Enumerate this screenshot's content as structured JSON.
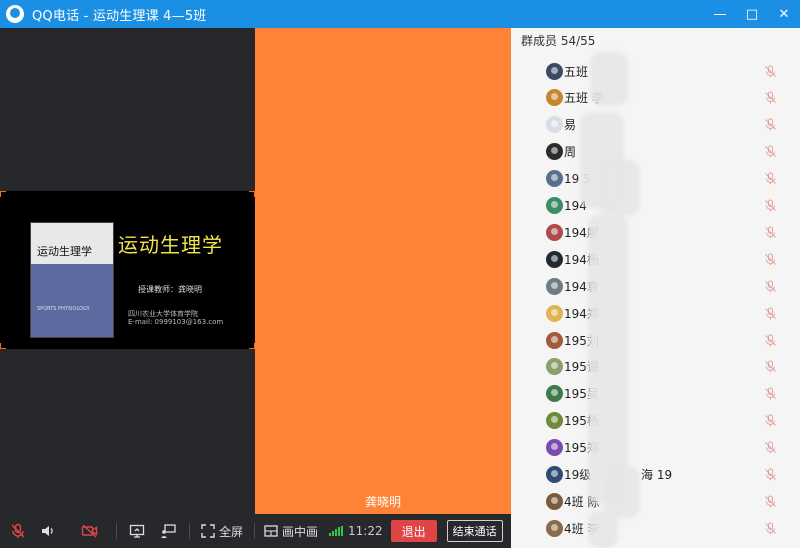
{
  "window": {
    "title": "QQ电话 - 运动生理课  4—5班",
    "controls": [
      "—",
      "□",
      "✕"
    ]
  },
  "slide": {
    "book_title": "运动生理学",
    "book_sub": "SPORTS PHYSIOLOGY",
    "title": "运动生理学",
    "teacher": "授课教师：龚晓明",
    "school": "四川农业大学体育学院",
    "email": "E-mail: 0999103@163.com"
  },
  "center": {
    "background": "#ff8237",
    "speaker": "龚晓明"
  },
  "toolbar": {
    "fullscreen_label": "全屏",
    "pip_label": "画中画",
    "time": "11:22",
    "exit_label": "退出",
    "end_call_label": "结束通话"
  },
  "members": {
    "header": "群成员 54/55",
    "list": [
      {
        "name": "五班",
        "avatar_color": "#3c4a63"
      },
      {
        "name": "五班 李",
        "avatar_color": "#c4862e"
      },
      {
        "name": "易",
        "avatar_color": "#d8dde6"
      },
      {
        "name": "周",
        "avatar_color": "#2d2b2a"
      },
      {
        "name": "19  5",
        "avatar_color": "#5a6f8e"
      },
      {
        "name": "194",
        "avatar_color": "#3c8c66"
      },
      {
        "name": "194廖",
        "avatar_color": "#b04a4a"
      },
      {
        "name": "194杨",
        "avatar_color": "#1f2a33"
      },
      {
        "name": "194袁",
        "avatar_color": "#6d7d86"
      },
      {
        "name": "194郑",
        "avatar_color": "#e0b453"
      },
      {
        "name": "195刘",
        "avatar_color": "#a15a3a"
      },
      {
        "name": "195谭",
        "avatar_color": "#8ba06a"
      },
      {
        "name": "195吴",
        "avatar_color": "#3d7a4c"
      },
      {
        "name": "195杨",
        "avatar_color": "#6e8a3a"
      },
      {
        "name": "195郑",
        "avatar_color": "#7a4ab0"
      },
      {
        "name": "19级",
        "suffix": "海  19",
        "avatar_color": "#2e4c73"
      },
      {
        "name": "4班 陈",
        "avatar_color": "#7c5a3e"
      },
      {
        "name": "4班 李",
        "avatar_color": "#8a6a4a"
      }
    ]
  }
}
